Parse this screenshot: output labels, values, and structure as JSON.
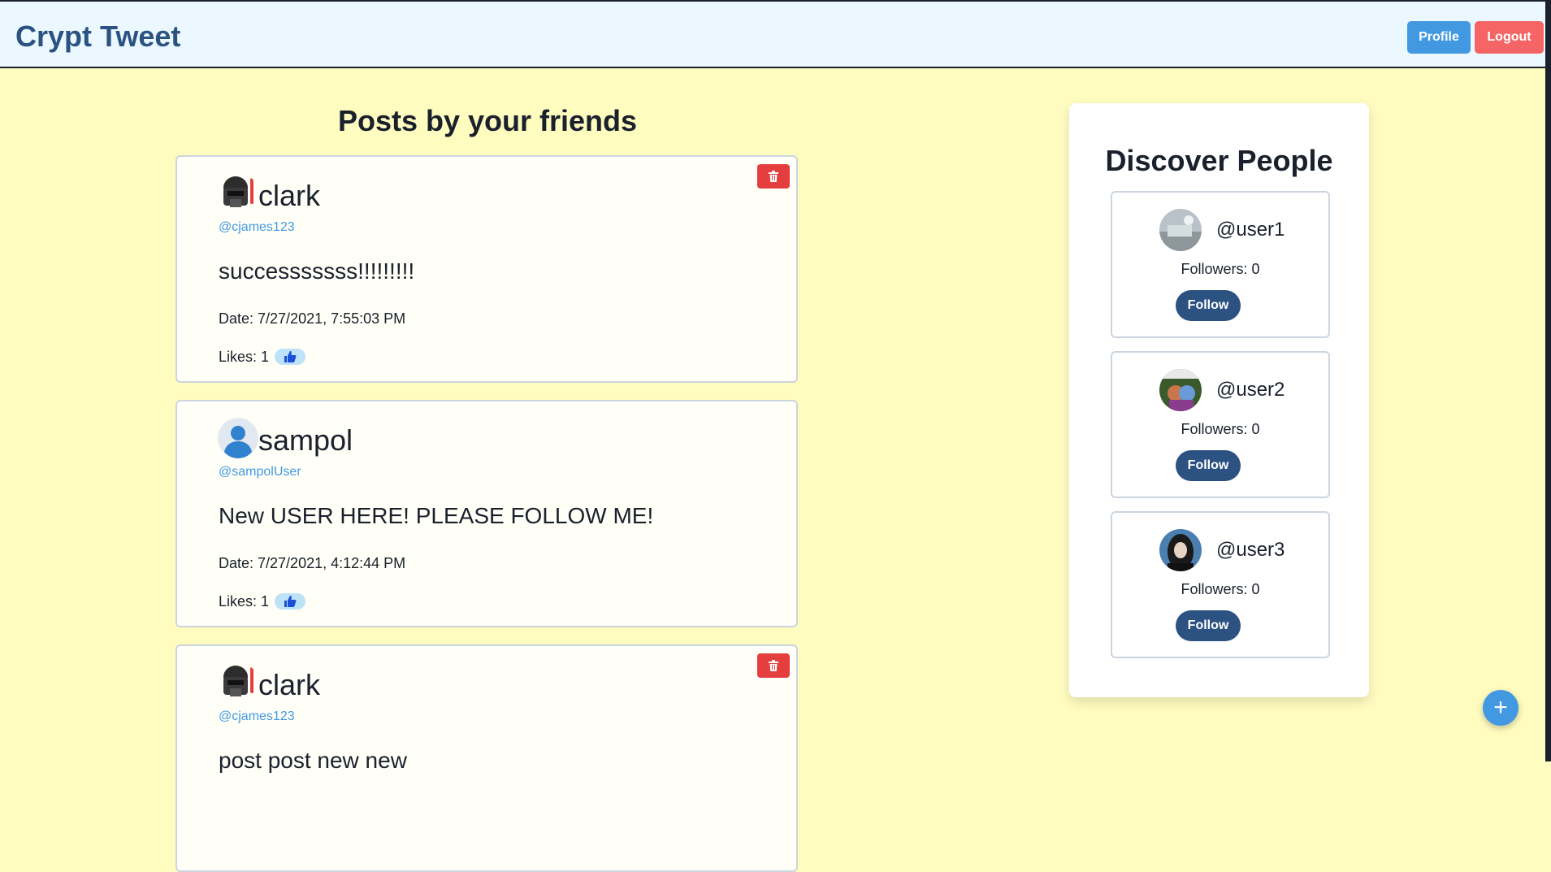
{
  "header": {
    "brand": "Crypt Tweet",
    "profile_label": "Profile",
    "logout_label": "Logout"
  },
  "feed": {
    "title": "Posts by your friends",
    "posts": [
      {
        "author": "clark",
        "handle": "@cjames123",
        "content": "successsssss!!!!!!!!!",
        "date": "Date: 7/27/2021, 7:55:03 PM",
        "likes": "Likes: 1",
        "avatar_icon": "darth-vader-avatar-icon",
        "deletable": true
      },
      {
        "author": "sampol",
        "handle": "@sampolUser",
        "content": "New USER HERE! PLEASE FOLLOW ME!",
        "date": "Date: 7/27/2021, 4:12:44 PM",
        "likes": "Likes: 1",
        "avatar_icon": "default-user-avatar-icon",
        "deletable": false
      },
      {
        "author": "clark",
        "handle": "@cjames123",
        "content": "post post new new",
        "avatar_icon": "darth-vader-avatar-icon",
        "deletable": true
      }
    ]
  },
  "discover": {
    "title": "Discover People",
    "users": [
      {
        "handle": "@user1",
        "followers": "Followers: 0",
        "follow_label": "Follow"
      },
      {
        "handle": "@user2",
        "followers": "Followers: 0",
        "follow_label": "Follow"
      },
      {
        "handle": "@user3",
        "followers": "Followers: 0",
        "follow_label": "Follow"
      }
    ]
  },
  "fab": {
    "label": "+"
  },
  "colors": {
    "background": "#fefcbf",
    "header_bg": "#ebf8ff",
    "brand": "#2c5282",
    "profile_btn": "#4299e1",
    "logout_btn": "#f56565",
    "delete_btn": "#e53e3e",
    "follow_btn": "#2c5282",
    "handle_link": "#4299e1"
  }
}
